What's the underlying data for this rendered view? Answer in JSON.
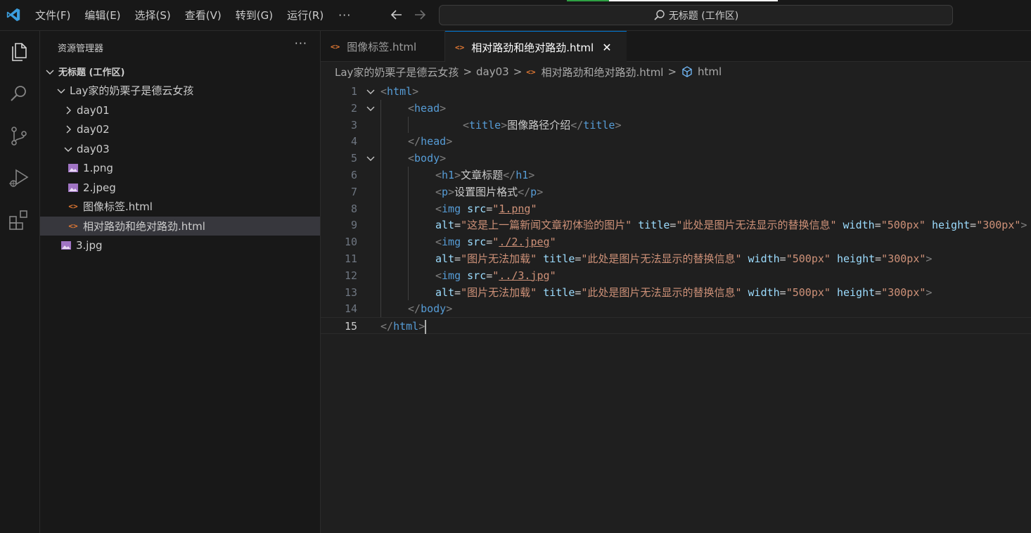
{
  "menu": {
    "items": [
      "文件(F)",
      "编辑(E)",
      "选择(S)",
      "查看(V)",
      "转到(G)",
      "运行(R)"
    ],
    "more": "···"
  },
  "command_center": {
    "text": "无标题 (工作区)"
  },
  "colors": {
    "accent": "#0078d4",
    "html_icon": "#e37933",
    "image_icon": "#a074c4"
  },
  "sidebar": {
    "title": "资源管理器",
    "more": "···",
    "tree": [
      {
        "label": "无标题 (工作区)",
        "kind": "workspace",
        "expanded": true
      },
      {
        "label": "Lay家的奶栗子是德云女孩",
        "kind": "folder",
        "expanded": true
      },
      {
        "label": "day01",
        "kind": "folder",
        "expanded": false
      },
      {
        "label": "day02",
        "kind": "folder",
        "expanded": false
      },
      {
        "label": "day03",
        "kind": "folder",
        "expanded": true
      },
      {
        "label": "1.png",
        "kind": "image"
      },
      {
        "label": "2.jpeg",
        "kind": "image"
      },
      {
        "label": "图像标签.html",
        "kind": "html"
      },
      {
        "label": "相对路劲和绝对路劲.html",
        "kind": "html",
        "selected": true
      },
      {
        "label": "3.jpg",
        "kind": "image"
      }
    ]
  },
  "tabs": [
    {
      "label": "图像标签.html",
      "active": false
    },
    {
      "label": "相对路劲和绝对路劲.html",
      "active": true,
      "close": "✕"
    }
  ],
  "breadcrumb": {
    "parts": [
      "Lay家的奶栗子是德云女孩",
      "day03",
      "相对路劲和绝对路劲.html",
      "html"
    ],
    "separator": ">"
  },
  "editor": {
    "current_line": 15,
    "lines": [
      {
        "n": "1",
        "fold": true,
        "tokens": [
          [
            "p",
            "<"
          ],
          [
            "t",
            "html"
          ],
          [
            "p",
            ">"
          ]
        ]
      },
      {
        "n": "2",
        "fold": true,
        "tokens": [
          [
            "p",
            "<"
          ],
          [
            "t",
            "head"
          ],
          [
            "p",
            ">"
          ]
        ]
      },
      {
        "n": "3",
        "tokens": [
          [
            "p",
            "<"
          ],
          [
            "t",
            "title"
          ],
          [
            "p",
            ">"
          ],
          [
            "x",
            "图像路径介绍"
          ],
          [
            "p",
            "</"
          ],
          [
            "t",
            "title"
          ],
          [
            "p",
            ">"
          ]
        ]
      },
      {
        "n": "4",
        "tokens": [
          [
            "p",
            "</"
          ],
          [
            "t",
            "head"
          ],
          [
            "p",
            ">"
          ]
        ]
      },
      {
        "n": "5",
        "fold": true,
        "tokens": [
          [
            "p",
            "<"
          ],
          [
            "t",
            "body"
          ],
          [
            "p",
            ">"
          ]
        ]
      },
      {
        "n": "6",
        "tokens": [
          [
            "p",
            "<"
          ],
          [
            "t",
            "h1"
          ],
          [
            "p",
            ">"
          ],
          [
            "x",
            "文章标题"
          ],
          [
            "p",
            "</"
          ],
          [
            "t",
            "h1"
          ],
          [
            "p",
            ">"
          ]
        ]
      },
      {
        "n": "7",
        "tokens": [
          [
            "p",
            "<"
          ],
          [
            "t",
            "p"
          ],
          [
            "p",
            ">"
          ],
          [
            "x",
            "设置图片格式"
          ],
          [
            "p",
            "</"
          ],
          [
            "t",
            "p"
          ],
          [
            "p",
            ">"
          ]
        ]
      },
      {
        "n": "8",
        "tokens": [
          [
            "p",
            "<"
          ],
          [
            "t",
            "img"
          ],
          [
            "x",
            " "
          ],
          [
            "a",
            "src"
          ],
          [
            "x",
            "="
          ],
          [
            "s",
            "\""
          ],
          [
            "u",
            "1.png"
          ],
          [
            "s",
            "\""
          ]
        ]
      },
      {
        "n": "9",
        "tokens": [
          [
            "a",
            "alt"
          ],
          [
            "x",
            "="
          ],
          [
            "s",
            "\"这是上一篇新闻文章初体验的图片\""
          ],
          [
            "x",
            " "
          ],
          [
            "a",
            "title"
          ],
          [
            "x",
            "="
          ],
          [
            "s",
            "\"此处是图片无法显示的替换信息\""
          ],
          [
            "x",
            " "
          ],
          [
            "a",
            "width"
          ],
          [
            "x",
            "="
          ],
          [
            "s",
            "\"500px\""
          ],
          [
            "x",
            " "
          ],
          [
            "a",
            "height"
          ],
          [
            "x",
            "="
          ],
          [
            "s",
            "\"300px\""
          ],
          [
            "p",
            ">"
          ]
        ]
      },
      {
        "n": "10",
        "tokens": [
          [
            "p",
            "<"
          ],
          [
            "t",
            "img"
          ],
          [
            "x",
            " "
          ],
          [
            "a",
            "src"
          ],
          [
            "x",
            "="
          ],
          [
            "s",
            "\""
          ],
          [
            "u",
            "./2.jpeg"
          ],
          [
            "s",
            "\""
          ]
        ]
      },
      {
        "n": "11",
        "tokens": [
          [
            "a",
            "alt"
          ],
          [
            "x",
            "="
          ],
          [
            "s",
            "\"图片无法加载\""
          ],
          [
            "x",
            " "
          ],
          [
            "a",
            "title"
          ],
          [
            "x",
            "="
          ],
          [
            "s",
            "\"此处是图片无法显示的替换信息\""
          ],
          [
            "x",
            " "
          ],
          [
            "a",
            "width"
          ],
          [
            "x",
            "="
          ],
          [
            "s",
            "\"500px\""
          ],
          [
            "x",
            " "
          ],
          [
            "a",
            "height"
          ],
          [
            "x",
            "="
          ],
          [
            "s",
            "\"300px\""
          ],
          [
            "p",
            ">"
          ]
        ]
      },
      {
        "n": "12",
        "tokens": [
          [
            "p",
            "<"
          ],
          [
            "t",
            "img"
          ],
          [
            "x",
            " "
          ],
          [
            "a",
            "src"
          ],
          [
            "x",
            "="
          ],
          [
            "s",
            "\""
          ],
          [
            "u",
            "../3.jpg"
          ],
          [
            "s",
            "\""
          ]
        ]
      },
      {
        "n": "13",
        "tokens": [
          [
            "a",
            "alt"
          ],
          [
            "x",
            "="
          ],
          [
            "s",
            "\"图片无法加载\""
          ],
          [
            "x",
            " "
          ],
          [
            "a",
            "title"
          ],
          [
            "x",
            "="
          ],
          [
            "s",
            "\"此处是图片无法显示的替换信息\""
          ],
          [
            "x",
            " "
          ],
          [
            "a",
            "width"
          ],
          [
            "x",
            "="
          ],
          [
            "s",
            "\"500px\""
          ],
          [
            "x",
            " "
          ],
          [
            "a",
            "height"
          ],
          [
            "x",
            "="
          ],
          [
            "s",
            "\"300px\""
          ],
          [
            "p",
            ">"
          ]
        ]
      },
      {
        "n": "14",
        "tokens": [
          [
            "p",
            "</"
          ],
          [
            "t",
            "body"
          ],
          [
            "p",
            ">"
          ]
        ]
      },
      {
        "n": "15",
        "tokens": [
          [
            "p",
            "</"
          ],
          [
            "t",
            "html"
          ],
          [
            "p",
            ">"
          ]
        ]
      }
    ]
  }
}
